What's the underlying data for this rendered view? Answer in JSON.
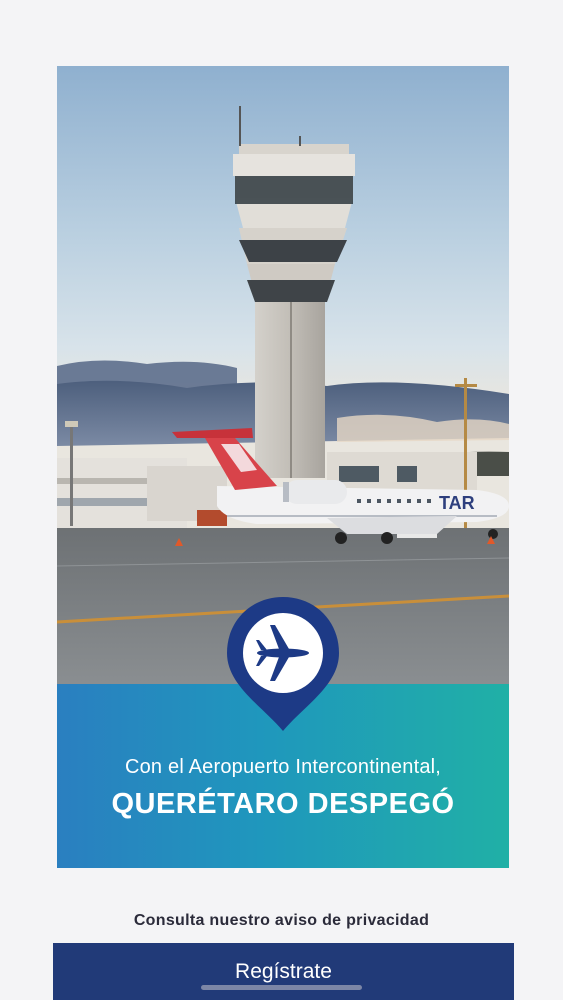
{
  "hero": {
    "tagline_line1": "Con el Aeropuerto Intercontinental,",
    "tagline_line2": "QUERÉTARO DESPEGÓ",
    "plane_livery_text": "TAR",
    "pin_icon": "airplane-location-pin-icon"
  },
  "footer": {
    "privacy_link": "Consulta nuestro aviso de privacidad",
    "register_button": "Regístrate"
  },
  "colors": {
    "button_bg": "#213a78",
    "banner_gradient_start": "#2a7fc0",
    "banner_gradient_end": "#20b0a6",
    "pin_color": "#1d3a86"
  }
}
